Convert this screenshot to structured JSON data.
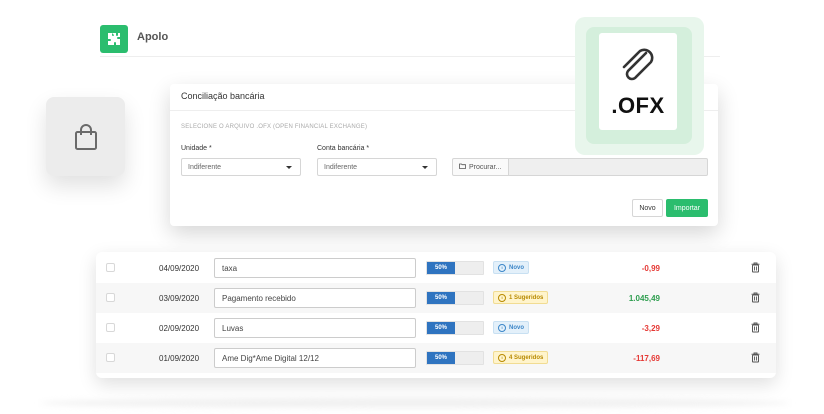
{
  "app": {
    "name": "Apolo"
  },
  "icons": {
    "logo": "puzzle-icon",
    "bag": "shopping-bag-icon",
    "attachment": "paperclip-icon",
    "folder": "folder-icon",
    "status": "info-icon",
    "delete": "trash-icon"
  },
  "colors": {
    "accent": "#2bbd6e",
    "progress": "#2f74c0",
    "negative": "#e53935",
    "positive": "#2e9e4f"
  },
  "ofx_badge": {
    "label": ".OFX"
  },
  "modal": {
    "title": "Conciliação bancária",
    "subtitle": "SELECIONE O ARQUIVO .OFX (OPEN FINANCIAL EXCHANGE)",
    "unidade": {
      "label": "Unidade *",
      "value": "Indiferente"
    },
    "conta": {
      "label": "Conta bancária *",
      "value": "Indiferente"
    },
    "browse_label": "Procurar...",
    "file_value": "",
    "novo_label": "Novo",
    "importar_label": "Importar"
  },
  "transactions": [
    {
      "date": "04/09/2020",
      "description": "taxa",
      "progress_label": "50%",
      "progress": 0.5,
      "status": "Novo",
      "amount": "-0,99"
    },
    {
      "date": "03/09/2020",
      "description": "Pagamento recebido",
      "progress_label": "50%",
      "progress": 0.5,
      "status": "1 Sugeridos",
      "amount": "1.045,49"
    },
    {
      "date": "02/09/2020",
      "description": "Luvas",
      "progress_label": "50%",
      "progress": 0.5,
      "status": "Novo",
      "amount": "-3,29"
    },
    {
      "date": "01/09/2020",
      "description": "Ame Dig*Ame Digital 12/12",
      "progress_label": "50%",
      "progress": 0.5,
      "status": "4 Sugeridos",
      "amount": "-117,69"
    }
  ]
}
